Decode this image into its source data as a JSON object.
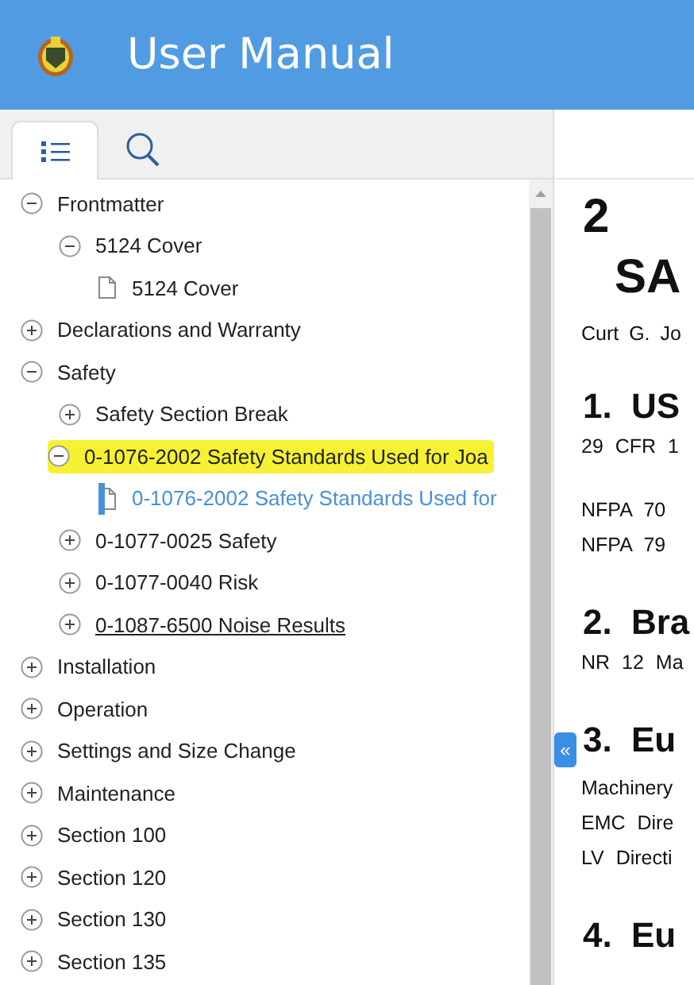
{
  "header": {
    "title": "User Manual"
  },
  "tabs": [
    {
      "kind": "contents",
      "selected": true
    },
    {
      "kind": "search",
      "selected": false
    }
  ],
  "toc": [
    {
      "kind": "folder",
      "label": "Frontmatter",
      "expanded": true,
      "selected": false,
      "highlighted": false,
      "hovered": false,
      "children": [
        {
          "kind": "folder",
          "label": "5124 Cover",
          "expanded": true,
          "selected": false,
          "highlighted": false,
          "hovered": false,
          "children": [
            {
              "kind": "page",
              "label": "5124 Cover",
              "selected": false,
              "highlighted": false,
              "hovered": false
            }
          ]
        }
      ]
    },
    {
      "kind": "folder",
      "label": "Declarations and Warranty",
      "expanded": false,
      "selected": false,
      "highlighted": false,
      "hovered": false
    },
    {
      "kind": "folder",
      "label": "Safety",
      "expanded": true,
      "selected": false,
      "highlighted": false,
      "hovered": false,
      "children": [
        {
          "kind": "folder",
          "label": "Safety Section Break",
          "expanded": false,
          "selected": false,
          "highlighted": false,
          "hovered": false
        },
        {
          "kind": "folder",
          "label": "0-1076-2002 Safety Standards Used for Joa",
          "expanded": true,
          "selected": false,
          "highlighted": true,
          "hovered": false,
          "children": [
            {
              "kind": "page",
              "label": "0-1076-2002 Safety Standards Used for",
              "selected": true,
              "highlighted": false,
              "hovered": false
            }
          ]
        },
        {
          "kind": "folder",
          "label": "0-1077-0025 Safety",
          "expanded": false,
          "selected": false,
          "highlighted": false,
          "hovered": false
        },
        {
          "kind": "folder",
          "label": "0-1077-0040 Risk",
          "expanded": false,
          "selected": false,
          "highlighted": false,
          "hovered": false
        },
        {
          "kind": "folder",
          "label": "0-1087-6500 Noise Results",
          "expanded": false,
          "selected": false,
          "highlighted": false,
          "hovered": true
        }
      ]
    },
    {
      "kind": "folder",
      "label": "Installation",
      "expanded": false,
      "selected": false,
      "highlighted": false,
      "hovered": false
    },
    {
      "kind": "folder",
      "label": "Operation",
      "expanded": false,
      "selected": false,
      "highlighted": false,
      "hovered": false
    },
    {
      "kind": "folder",
      "label": "Settings and Size Change",
      "expanded": false,
      "selected": false,
      "highlighted": false,
      "hovered": false
    },
    {
      "kind": "folder",
      "label": "Maintenance",
      "expanded": false,
      "selected": false,
      "highlighted": false,
      "hovered": false
    },
    {
      "kind": "folder",
      "label": "Section 100",
      "expanded": false,
      "selected": false,
      "highlighted": false,
      "hovered": false
    },
    {
      "kind": "folder",
      "label": "Section 120",
      "expanded": false,
      "selected": false,
      "highlighted": false,
      "hovered": false
    },
    {
      "kind": "folder",
      "label": "Section 130",
      "expanded": false,
      "selected": false,
      "highlighted": false,
      "hovered": false
    },
    {
      "kind": "folder",
      "label": "Section 135",
      "expanded": false,
      "selected": false,
      "highlighted": false,
      "hovered": false
    }
  ],
  "document": {
    "collapse_button": "«",
    "blocks": [
      {
        "kind": "title",
        "text": "2"
      },
      {
        "kind": "subtitle",
        "text": "SA"
      },
      {
        "kind": "author",
        "text": "Curt G. Jo"
      },
      {
        "kind": "heading",
        "text": "1. US"
      },
      {
        "kind": "para",
        "text": "29 CFR 1"
      },
      {
        "kind": "para_gap",
        "text": "NFPA 70"
      },
      {
        "kind": "para",
        "text": "NFPA 79"
      },
      {
        "kind": "heading",
        "text": "2. Bra"
      },
      {
        "kind": "para",
        "text": "NR 12 Ma"
      },
      {
        "kind": "heading",
        "text": "3. Eu"
      },
      {
        "kind": "para_tight",
        "text": "Machinery"
      },
      {
        "kind": "para",
        "text": "EMC Dire"
      },
      {
        "kind": "para",
        "text": "LV Directi"
      },
      {
        "kind": "heading",
        "text": "4. Eu"
      }
    ]
  }
}
